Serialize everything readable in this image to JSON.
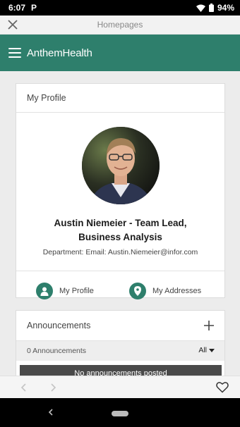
{
  "status_bar": {
    "time": "6:07",
    "app_indicator": "P",
    "battery": "94%"
  },
  "browser": {
    "title": "Homepages"
  },
  "app": {
    "brand": "AnthemHealth",
    "accent_color": "#2e7f6c"
  },
  "profile": {
    "section_title": "My Profile",
    "name_line1": "Austin Niemeier - Team Lead,",
    "name_line2": "Business Analysis",
    "details": "Department: Email: Austin.Niemeier@infor.com",
    "links": [
      {
        "label": "My Profile",
        "icon": "person-icon"
      },
      {
        "label": "My Addresses",
        "icon": "location-pin-icon"
      }
    ]
  },
  "announcements": {
    "title": "Announcements",
    "count_text": "0 Announcements",
    "filter": "All",
    "empty_message": "No announcements posted"
  }
}
